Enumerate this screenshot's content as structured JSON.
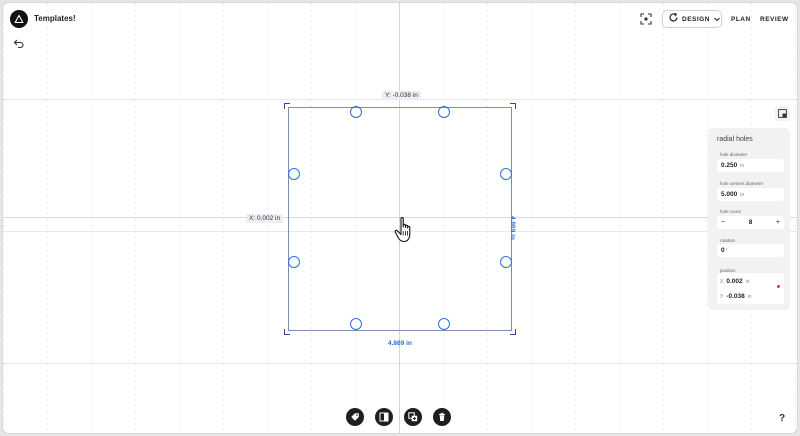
{
  "app": {
    "title": "Templates!"
  },
  "header": {
    "mode_label": "DESIGN",
    "nav_plan": "PLAN",
    "nav_review": "REVIEW"
  },
  "canvas": {
    "y_offset_label": "Y: -0.038 in",
    "x_offset_label": "X: 0.002 in",
    "width_label": "4.869 in",
    "height_label": "4.869 in"
  },
  "panel": {
    "title": "radial holes",
    "hole_diameter": {
      "label": "hole diameter",
      "value": "0.250",
      "unit": "in"
    },
    "hole_centers_diameter": {
      "label": "hole centers diameter",
      "value": "5.000",
      "unit": "in"
    },
    "hole_count": {
      "label": "hole count",
      "value": "8",
      "minus": "−",
      "plus": "+"
    },
    "rotation": {
      "label": "rotation",
      "value": "0",
      "unit": "°"
    },
    "position": {
      "label": "position",
      "x_axis": "X",
      "x_value": "0.002",
      "x_unit": "in",
      "y_axis": "Y",
      "y_value": "-0.038",
      "y_unit": "in"
    }
  },
  "footer": {
    "help": "?"
  },
  "colors": {
    "accent": "#2e6fd9",
    "toolbar": "#1f1f23",
    "indicator": "#e0304a"
  },
  "icons": [
    "logo-icon",
    "undo-icon",
    "scan-icon",
    "refresh-icon",
    "chevron-down-icon",
    "panel-toggle-icon",
    "pointer-hand-icon",
    "tag-icon",
    "split-icon",
    "add-layer-icon",
    "trash-icon"
  ]
}
